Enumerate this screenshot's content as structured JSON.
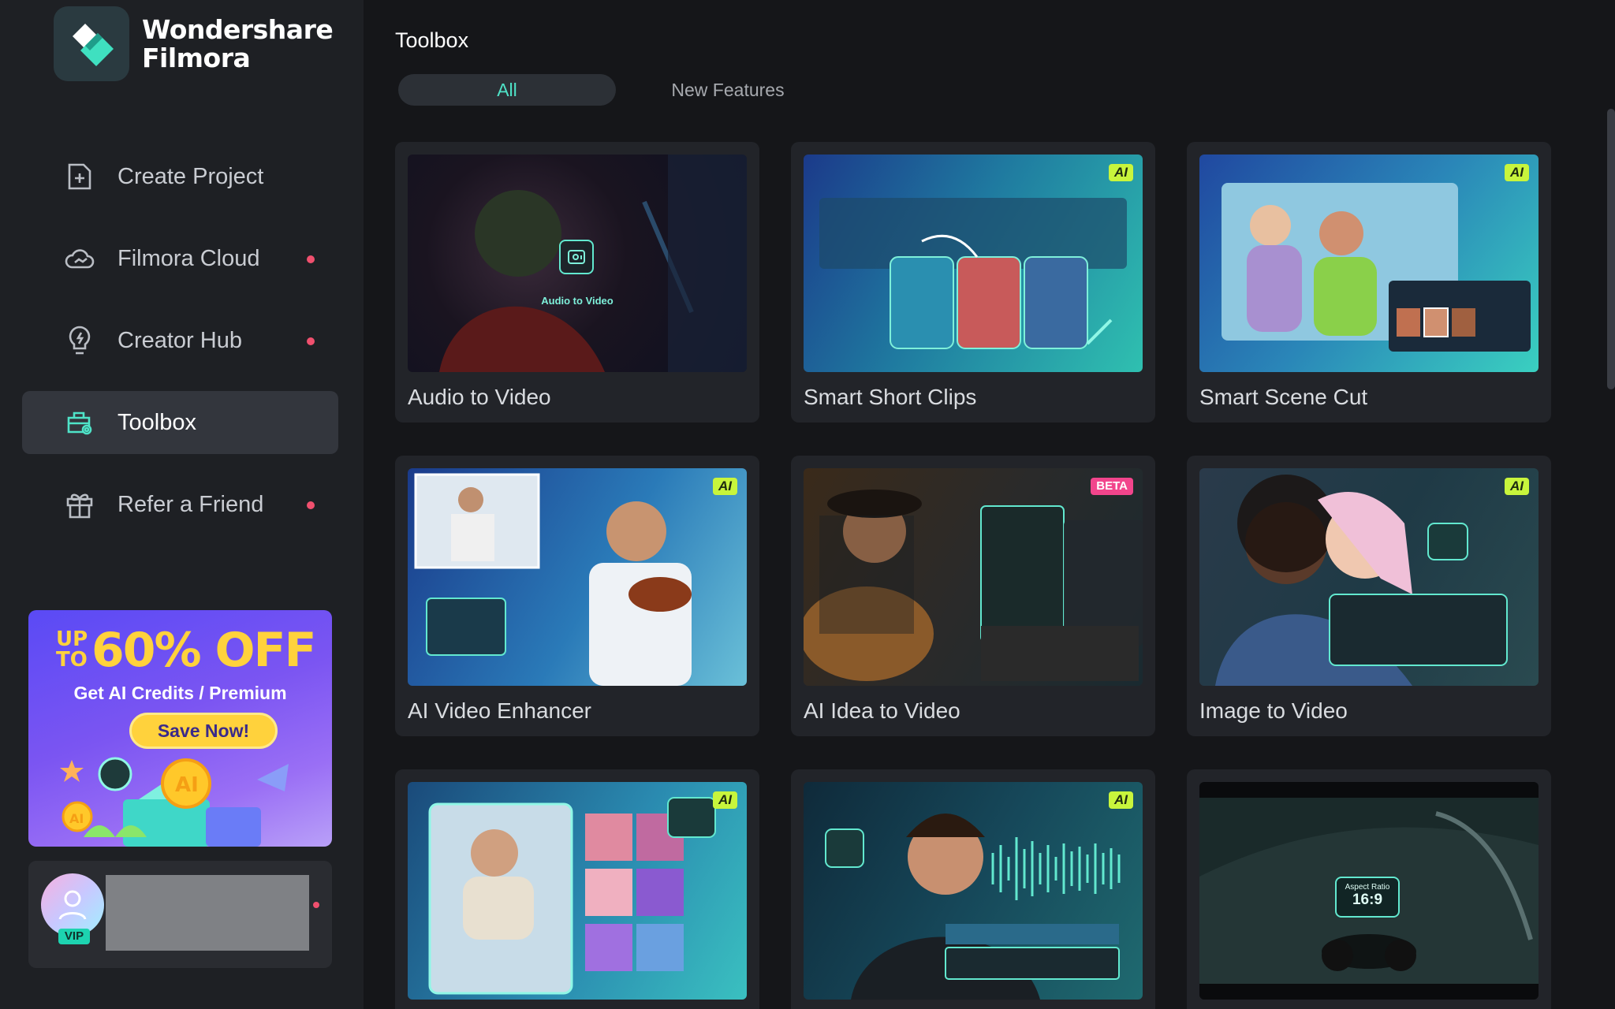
{
  "app": {
    "logo_line1": "Wondershare",
    "logo_line2": "Filmora"
  },
  "sidebar": {
    "items": [
      {
        "label": "Create Project",
        "icon": "create-project-icon",
        "dot": false,
        "active": false
      },
      {
        "label": "Filmora Cloud",
        "icon": "cloud-icon",
        "dot": true,
        "active": false
      },
      {
        "label": "Creator Hub",
        "icon": "lightbulb-icon",
        "dot": true,
        "active": false
      },
      {
        "label": "Toolbox",
        "icon": "toolbox-icon",
        "dot": false,
        "active": true
      },
      {
        "label": "Refer a Friend",
        "icon": "gift-icon",
        "dot": true,
        "active": false
      }
    ],
    "promo": {
      "up_to": "UP TO",
      "percent": "60% OFF",
      "subtitle": "Get AI Credits / Premium",
      "button": "Save Now!"
    },
    "user": {
      "badge": "VIP"
    }
  },
  "main": {
    "title": "Toolbox",
    "tabs": [
      {
        "label": "All",
        "active": true
      },
      {
        "label": "New Features",
        "active": false
      }
    ],
    "cards": [
      {
        "label": "Audio to Video",
        "badge": "",
        "thumb_caption": "Audio to Video"
      },
      {
        "label": "Smart Short Clips",
        "badge": "AI"
      },
      {
        "label": "Smart Scene Cut",
        "badge": "AI"
      },
      {
        "label": "AI Video Enhancer",
        "badge": "AI"
      },
      {
        "label": "AI Idea to Video",
        "badge": "BETA"
      },
      {
        "label": "Image to Video",
        "badge": "AI"
      },
      {
        "label": "",
        "badge": "AI"
      },
      {
        "label": "",
        "badge": "AI"
      },
      {
        "label": "",
        "badge": "",
        "thumb_caption": "Aspect Ratio",
        "thumb_value": "16:9"
      }
    ]
  },
  "colors": {
    "accent": "#4fe3c8",
    "notify_dot": "#f0506e",
    "ai_badge": "#c8f53c",
    "beta_badge": "#f2458c"
  }
}
